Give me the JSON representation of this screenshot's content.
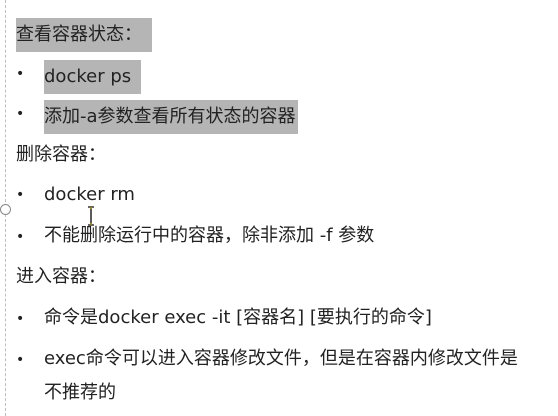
{
  "sections": [
    {
      "heading": "查看容器状态：",
      "items": [
        "docker ps",
        "添加-a参数查看所有状态的容器"
      ]
    },
    {
      "heading": "删除容器：",
      "items": [
        "docker rm",
        "不能删除运行中的容器，除非添加 -f 参数"
      ]
    },
    {
      "heading": "进入容器：",
      "items": [
        "命令是docker exec -it [容器名] [要执行的命令]",
        "exec命令可以进入容器修改文件，但是在容器内修改文件是",
        "不推荐的"
      ]
    }
  ],
  "bullet_char": "•"
}
